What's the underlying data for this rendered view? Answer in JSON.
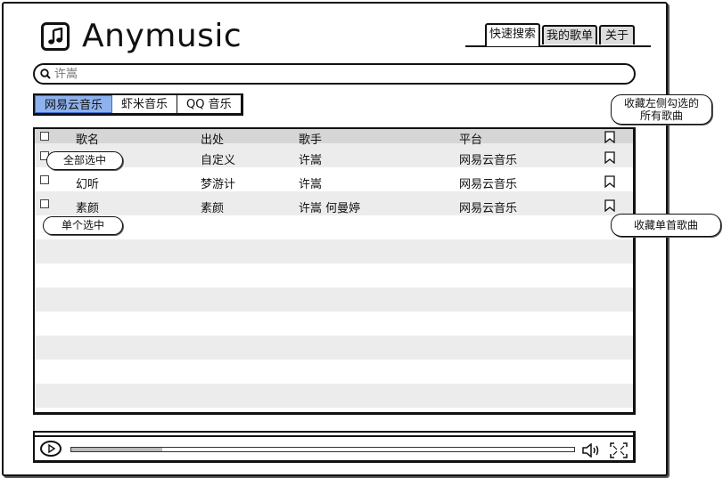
{
  "app": {
    "title": "Anymusic",
    "logo_icon": "music-note-icon"
  },
  "tabs": [
    {
      "label": "快速搜索",
      "active": true
    },
    {
      "label": "我的歌单",
      "active": false
    },
    {
      "label": "关于",
      "active": false
    }
  ],
  "search": {
    "placeholder": "许嵩",
    "icon": "search-icon"
  },
  "platforms": [
    {
      "label": "网易云音乐",
      "selected": true
    },
    {
      "label": "虾米音乐",
      "selected": false
    },
    {
      "label": "QQ 音乐",
      "selected": false
    }
  ],
  "table": {
    "headers": {
      "song": "歌名",
      "source": "出处",
      "singer": "歌手",
      "platform": "平台"
    },
    "rows": [
      {
        "song": "",
        "source": "自定义",
        "singer": "许嵩",
        "platform": "网易云音乐"
      },
      {
        "song": "幻听",
        "source": "梦游计",
        "singer": "许嵩",
        "platform": "网易云音乐"
      },
      {
        "song": "素颜",
        "source": "素颜",
        "singer": "许嵩 何曼婷",
        "platform": "网易云音乐"
      }
    ]
  },
  "annotations": {
    "select_all": "全部选中",
    "select_single": "单个选中",
    "collect_all_line1": "收藏左侧勾选的",
    "collect_all_line2": "所有歌曲",
    "collect_single": "收藏单首歌曲"
  },
  "player": {
    "progress": 0.18,
    "play_icon": "play-icon",
    "volume_icon": "volume-icon",
    "fullscreen_icon": "fullscreen-icon"
  },
  "colors": {
    "selected_platform": "#8fb2ee",
    "header_row": "#d6d6d6",
    "stripe": "#ececec"
  }
}
